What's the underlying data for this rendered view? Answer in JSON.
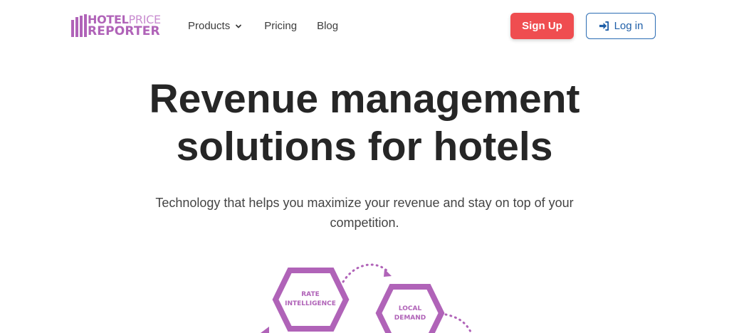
{
  "brand": {
    "line1_bold": "HOTEL",
    "line1_light": "PRICE",
    "line2": "REPORTER",
    "color": "#b063b8"
  },
  "nav": [
    {
      "label": "Products",
      "has_dropdown": true
    },
    {
      "label": "Pricing"
    },
    {
      "label": "Blog"
    }
  ],
  "auth": {
    "signup_label": "Sign Up",
    "login_label": "Log in",
    "signup_color": "#ef4d50",
    "login_color": "#1f5fa8"
  },
  "hero": {
    "title_line1": "Revenue management",
    "title_line2": "solutions for hotels",
    "subtitle_line1": "Technology that helps you maximize your revenue and stay on top of your",
    "subtitle_line2": "competition."
  },
  "diagram": {
    "hex1": {
      "line1": "RATE",
      "line2": "INTELLIGENCE"
    },
    "hex2": {
      "line1": "LOCAL",
      "line2": "DEMAND"
    }
  },
  "icons": {
    "dropdown": "chevron-down-icon",
    "login": "sign-in-icon",
    "logo": "bar-chart-icon"
  }
}
